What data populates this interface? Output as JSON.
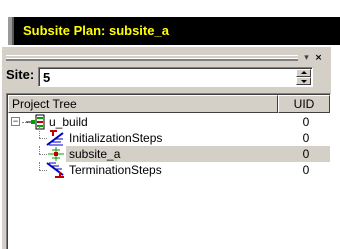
{
  "title_bar": {
    "title": "Subsite Plan: subsite_a"
  },
  "panel": {
    "pin_glyph": "▾",
    "close_glyph": "×",
    "site_label": "Site:",
    "site_value": "5"
  },
  "tree": {
    "columns": {
      "tree": "Project Tree",
      "uid": "UID"
    },
    "rows": [
      {
        "label": "u_build",
        "uid": "0",
        "icon": "build-icon",
        "selected": false
      },
      {
        "label": "InitializationSteps",
        "uid": "0",
        "icon": "initialization-steps-icon",
        "selected": false
      },
      {
        "label": "subsite_a",
        "uid": "0",
        "icon": "subsite-icon",
        "selected": true
      },
      {
        "label": "TerminationSteps",
        "uid": "0",
        "icon": "termination-steps-icon",
        "selected": false
      }
    ]
  },
  "colors": {
    "title_bg": "#000000",
    "title_text": "#ffff00",
    "panel_bg": "#d4d0c8",
    "selection_bg": "#d4d0c8"
  }
}
